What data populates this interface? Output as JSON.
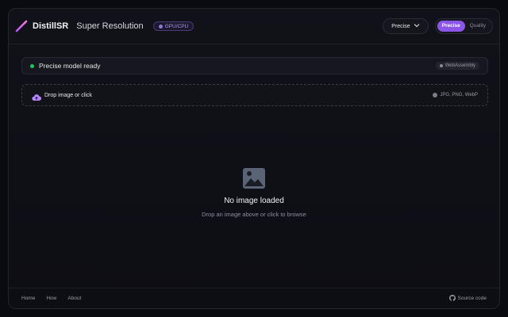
{
  "header": {
    "brand": "DistillSR",
    "tagline": "Super Resolution",
    "badge": "GPU/CPU",
    "model_select": "Precise",
    "mode_toggle": [
      "Precise",
      "Quality"
    ],
    "active_mode": "Precise"
  },
  "status": {
    "text": "Precise model ready",
    "runtime": "WebAssembly",
    "color": "#22c55e"
  },
  "dropzone": {
    "label": "Drop image or click",
    "formats": "JPG, PNG, WebP",
    "accent": "#b784ff"
  },
  "empty_state": {
    "title": "No image loaded",
    "subtitle": "Drop an image above or click to browse",
    "icon": "image-icon"
  },
  "footer": {
    "links": [
      "Home",
      "How",
      "About"
    ],
    "source": "Source code"
  },
  "colors": {
    "accent": "#8b55e8",
    "background": "#0a0b10"
  }
}
